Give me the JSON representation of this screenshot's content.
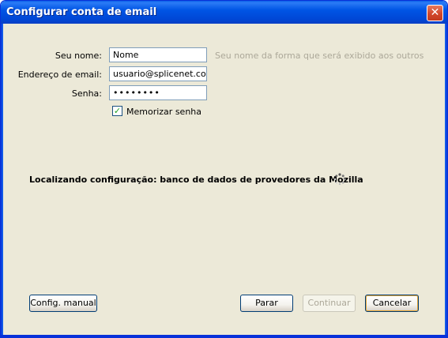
{
  "window": {
    "title": "Configurar conta de email",
    "close_glyph": "✕"
  },
  "form": {
    "name_label": "Seu nome:",
    "name_value": "Nome",
    "name_hint": "Seu nome da forma que será exibido aos outros",
    "email_label": "Endereço de email:",
    "email_value": "usuario@splicenet.com.b",
    "password_label": "Senha:",
    "password_value": "••••••••",
    "remember_label": "Memorizar senha",
    "remember_checked": true
  },
  "status": {
    "text": "Localizando configuração: banco de dados de provedores da Mozilla",
    "spinner_icon": "loading-spinner-icon"
  },
  "buttons": {
    "manual": "Config. manual",
    "stop": "Parar",
    "continue": "Continuar",
    "cancel": "Cancelar"
  },
  "colors": {
    "titlebar": "#0055e5",
    "dialog_bg": "#ece9d8",
    "hint": "#aca899"
  }
}
